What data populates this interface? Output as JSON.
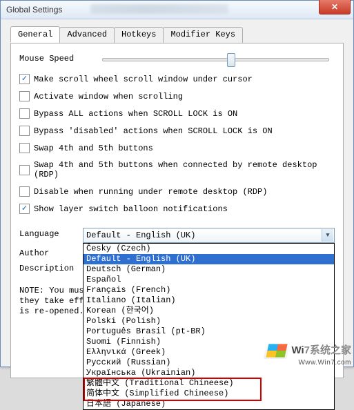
{
  "window": {
    "title": "Global Settings",
    "close_glyph": "✕"
  },
  "tabs": [
    {
      "label": "General"
    },
    {
      "label": "Advanced"
    },
    {
      "label": "Hotkeys"
    },
    {
      "label": "Modifier Keys"
    }
  ],
  "mouse_speed": {
    "label": "Mouse Speed"
  },
  "checks": [
    {
      "label": "Make scroll wheel scroll window under cursor",
      "checked": true
    },
    {
      "label": "Activate window when scrolling",
      "checked": false
    },
    {
      "label": "Bypass ALL actions when SCROLL LOCK is ON",
      "checked": false
    },
    {
      "label": "Bypass 'disabled' actions when SCROLL LOCK is ON",
      "checked": false
    },
    {
      "label": "Swap 4th and 5th buttons",
      "checked": false
    },
    {
      "label": "Swap 4th and 5th buttons when connected by remote desktop (RDP)",
      "checked": false
    },
    {
      "label": "Disable when running under remote desktop (RDP)",
      "checked": false
    },
    {
      "label": "Show layer switch balloon notifications",
      "checked": true
    }
  ],
  "language": {
    "label": "Language",
    "selected": "Default - English (UK)",
    "options": [
      "Česky (Czech)",
      "Default - English (UK)",
      "Deutsch (German)",
      "Español",
      "Français (French)",
      "Italiano (Italian)",
      "Korean (한국어)",
      "Polski (Polish)",
      "Português Brasil (pt-BR)",
      "Suomi (Finnish)",
      "Ελληνικά (Greek)",
      "Русский (Russian)",
      "Українська (Ukrainian)",
      "繁體中文 (Traditional Chineese)",
      "简体中文 (Simplified Chineese)",
      "日本語 (Japanese)"
    ]
  },
  "author": {
    "label": "Author"
  },
  "description": {
    "label": "Description"
  },
  "note": {
    "l1": "NOTE: You must",
    "l2": "they take effe",
    "l3": "is re-opened."
  },
  "watermark": {
    "brand_prefix": "Wi",
    "brand_suffix": "7系统之家",
    "url": "Www.Win7.com"
  }
}
